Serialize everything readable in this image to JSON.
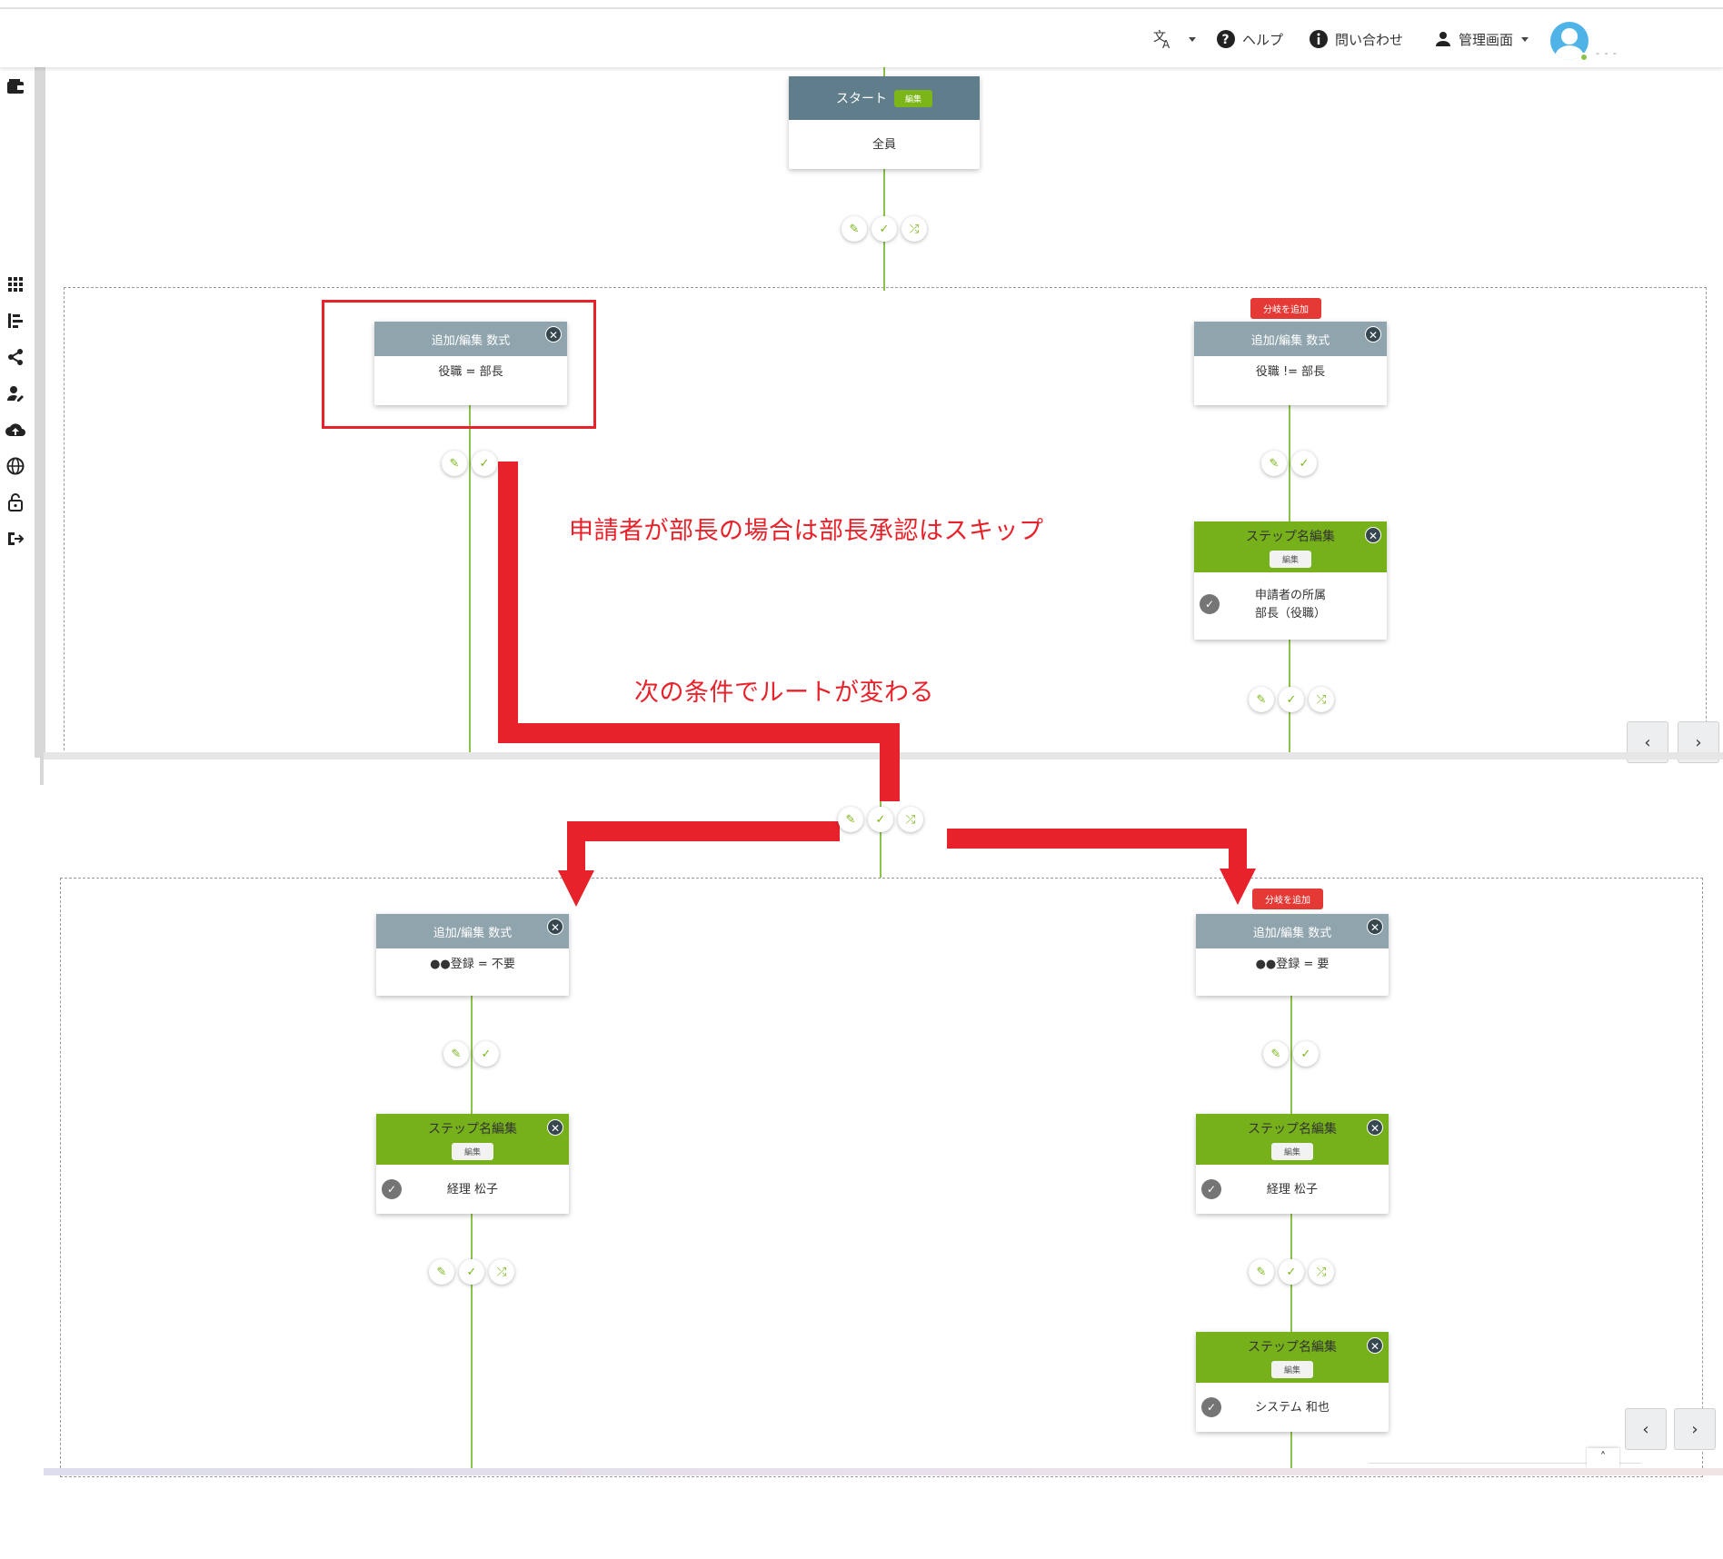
{
  "header": {
    "translate_label": "",
    "help_label": "ヘルプ",
    "contact_label": "問い合わせ",
    "admin_label": "管理画面",
    "user_name": "- - -"
  },
  "flow": {
    "start": {
      "title": "スタート",
      "edit_badge": "編集",
      "body": "全員"
    },
    "branch1": {
      "left": {
        "title": "追加/編集 数式",
        "condition": "役職 = 部長"
      },
      "right": {
        "add_branch": "分岐を追加",
        "title": "追加/編集 数式",
        "condition": "役職 != 部長"
      },
      "right_step": {
        "title": "ステップ名編集",
        "edit": "編集",
        "line1": "申請者の所属",
        "line2": "部長（役職）"
      }
    },
    "branch2": {
      "left": {
        "title": "追加/編集 数式",
        "condition": "●●登録 = 不要"
      },
      "right": {
        "add_branch": "分岐を追加",
        "title": "追加/編集 数式",
        "condition": "●●登録 = 要"
      },
      "left_step": {
        "title": "ステップ名編集",
        "edit": "編集",
        "approver": "経理 松子"
      },
      "right_step": {
        "title": "ステップ名編集",
        "edit": "編集",
        "approver": "経理 松子"
      },
      "right_step2": {
        "title": "ステップ名編集",
        "edit": "編集",
        "approver": "システム 和也"
      }
    }
  },
  "annotations": {
    "note1": "申請者が部長の場合は部長承認はスキップ",
    "note2": "次の条件でルートが変わる"
  },
  "nav": {
    "prev": "‹",
    "next": "›",
    "scroll_top": "˄"
  },
  "colors": {
    "accent_green": "#7cb518",
    "connector": "#8bc34a",
    "header_grey": "#90a4ae",
    "annotation_red": "#e8222b"
  }
}
